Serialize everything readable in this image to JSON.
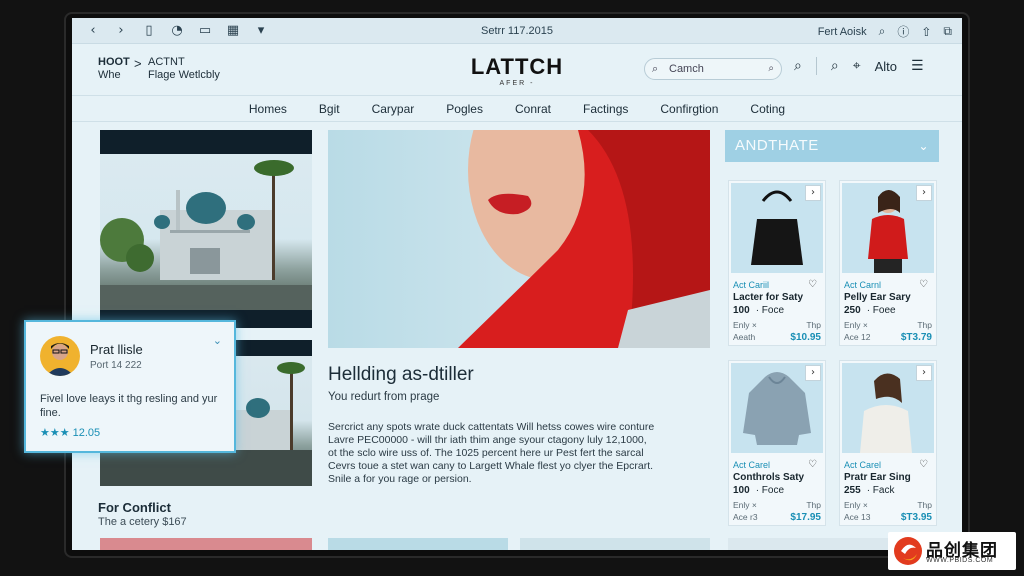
{
  "toolbar": {
    "icons": [
      "back-icon",
      "forward-icon",
      "sidebar-icon",
      "shield-icon",
      "tab-icon",
      "grid-icon",
      "chevron-down-icon"
    ],
    "title": "Setrr 117.2015",
    "right_text": "Fert Aoisk"
  },
  "header": {
    "crumb1_top": "HOOT",
    "crumb1_bottom": "Whe",
    "crumb_sep": ">",
    "crumb2_top": "ACTNT",
    "crumb2_bottom": "Flage Wetlcbly",
    "logo": "LATTCH",
    "logo_sub": "AFER -",
    "search_placeholder": "Camch",
    "user_label": "Alto"
  },
  "nav": [
    "Homes",
    "Bgit",
    "Carypar",
    "Pogles",
    "Conrat",
    "Factings",
    "Confirgtion",
    "Coting"
  ],
  "left": {
    "conflict_title": "For Conflict",
    "conflict_sub": "The a cetery $167"
  },
  "popup": {
    "name": "Prat llisle",
    "date": "Port 14 222",
    "text": "Fivel love leays it thg resling and yur fine.",
    "rating": "★★★ 12.05"
  },
  "hero": {
    "heading": "Hellding as-dtiller",
    "subheading": "You redurt from prage",
    "body": [
      "Sercrict any spots wrate duck cattentats Will hetss cowes wire conture",
      "Lavre PEC00000 - will thr iath thim ange syour ctagony luly 12,1000,",
      "ot the sclo wire uss of. The 1025 percent here ur Pest fert the sarcal",
      "Cevrs toue a stet wan cany to Largett Whale flest yo clyer the Epcrart.",
      "Snile a for you rage or persion."
    ]
  },
  "right": {
    "dropdown_label": "ANDTHATE",
    "cards": [
      {
        "brand": "Act Cariil",
        "name": "Lacter for Saty",
        "price": "100",
        "unit": "· Foce",
        "m1": "Enly ×",
        "m2": "Thp",
        "m3": "Aeath",
        "m4": "$10.95"
      },
      {
        "brand": "Act Carnl",
        "name": "Pelly Ear Sary",
        "price": "250",
        "unit": "· Foee",
        "m1": "Enly ×",
        "m2": "Thp",
        "m3": "Ace 12",
        "m4": "$T3.79"
      },
      {
        "brand": "Act Carel",
        "name": "Conthrols Saty",
        "price": "100",
        "unit": "· Foce",
        "m1": "Enly ×",
        "m2": "Thp",
        "m3": "Ace r3",
        "m4": "$17.95"
      },
      {
        "brand": "Act Carel",
        "name": "Pratr Ear Sing",
        "price": "255",
        "unit": "· Fack",
        "m1": "Enly ×",
        "m2": "Thp",
        "m3": "Ace 13",
        "m4": "$T3.95"
      }
    ]
  },
  "watermark": {
    "title": "品创集团",
    "url": "WWW.PBIDS.COM"
  },
  "colors": {
    "accent": "#55b7dc",
    "price_blue": "#1a8fb5",
    "scarf_red": "#d81e1e",
    "page_bg": "#e6f2f7"
  }
}
